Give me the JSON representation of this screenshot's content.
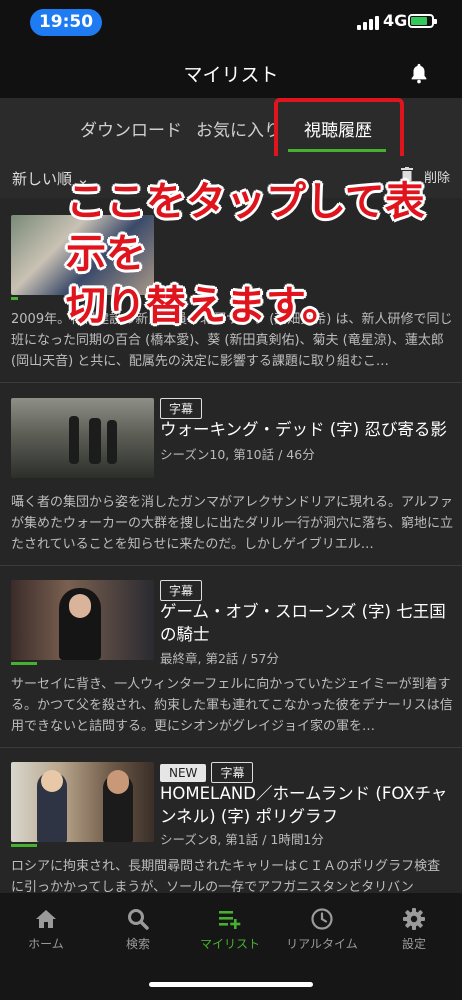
{
  "status_bar": {
    "time": "19:50",
    "network": "4G"
  },
  "header": {
    "title": "マイリスト",
    "bell_icon": "bell-icon"
  },
  "tabs": [
    {
      "label": "ダウンロード"
    },
    {
      "label": "お気に入り"
    },
    {
      "label": "視聴履歴",
      "active": true
    }
  ],
  "sort": {
    "label": "新しい順 ⌄",
    "delete_label": "削除"
  },
  "annotation": {
    "line1": "ここをタップして表示を",
    "line2": "切り替えます。"
  },
  "items": [
    {
      "title": "",
      "desc": "2009年。花村建設の新入社員・北野サクラ (高畑充希) は、新人研修で同じ班になった同期の百合 (橋本愛)、葵 (新田真剣佑)、菊夫 (竜星涼)、蓮太郎 (岡山天音) と共に、配属先の決定に影響する課題に取り組むこ…",
      "progress": 0.05
    },
    {
      "badges": [
        "字幕"
      ],
      "title": "ウォーキング・デッド (字) 忍び寄る影",
      "sub": "シーズン10, 第10話 / 46分",
      "desc": "囁く者の集団から姿を消したガンマがアレクサンドリアに現れる。アルファが集めたウォーカーの大群を捜しに出たダリル一行が洞穴に落ち、窮地に立たされていることを知らせに来たのだ。しかしゲイブリエル…",
      "progress": 0
    },
    {
      "badges": [
        "字幕"
      ],
      "title": "ゲーム・オブ・スローンズ (字) 七王国の騎士",
      "sub": "最終章, 第2話 / 57分",
      "desc": "サーセイに背き、一人ウィンターフェルに向かっていたジェイミーが到着する。かつて父を殺され、約束した軍も連れてこなかった彼をデナーリスは信用できないと詰問する。更にシオンがグレイジョイ家の軍を…",
      "progress": 0.18
    },
    {
      "badges": [
        "NEW",
        "字幕"
      ],
      "title": "HOMELAND／ホームランド (FOXチャンネル) (字) ポリグラフ",
      "sub": "シーズン8, 第1話 / 1時間1分",
      "desc": "ロシアに拘束され、長期間尋問されたキャリーはＣＩＡのポリグラフ検査に引っかかってしまうが、ソールの一存でアフガニスタンとタリバン",
      "progress": 0.18
    }
  ],
  "bottom_nav": [
    {
      "label": "ホーム",
      "icon": "home-icon"
    },
    {
      "label": "検索",
      "icon": "search-icon"
    },
    {
      "label": "マイリスト",
      "icon": "mylist-icon",
      "active": true
    },
    {
      "label": "リアルタイム",
      "icon": "clock-icon"
    },
    {
      "label": "設定",
      "icon": "gear-icon"
    }
  ],
  "colors": {
    "accent": "#46b12f",
    "annotation": "#e0141c",
    "status_time_pill": "#1e7bf2"
  }
}
